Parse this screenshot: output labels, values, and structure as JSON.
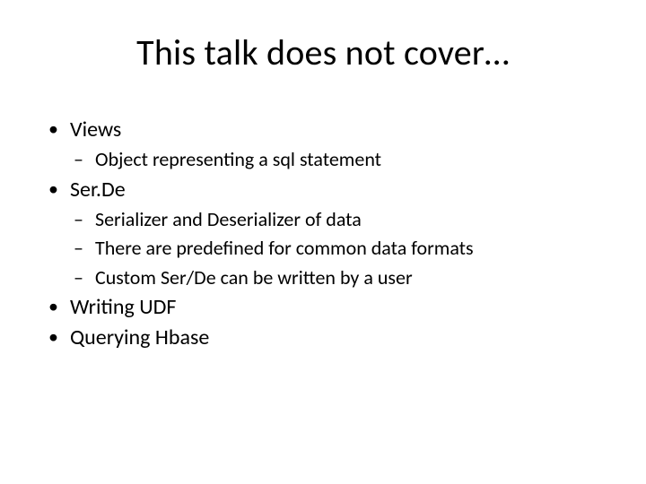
{
  "title": "This talk does not cover…",
  "items": [
    {
      "label": "Views",
      "sub": [
        "Object representing a sql statement"
      ]
    },
    {
      "label": "Ser.De",
      "sub": [
        "Serializer and Deserializer of data",
        "There are predefined for common data formats",
        "Custom Ser/De can be written by a user"
      ]
    },
    {
      "label": "Writing UDF",
      "sub": []
    },
    {
      "label": "Querying Hbase",
      "sub": []
    }
  ]
}
